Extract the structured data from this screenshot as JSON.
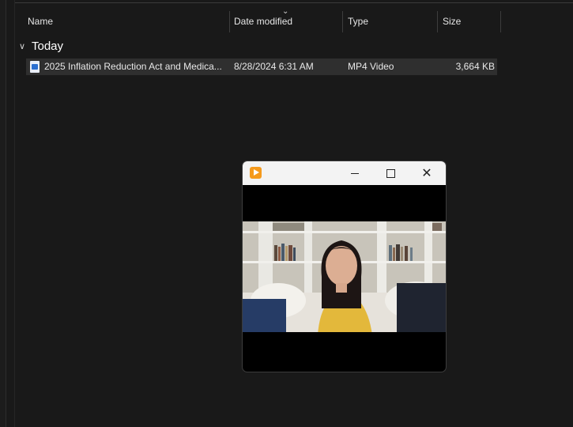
{
  "columns": {
    "name": "Name",
    "date_modified": "Date modified",
    "type": "Type",
    "size": "Size"
  },
  "group": {
    "label": "Today"
  },
  "files": [
    {
      "name": "2025 Inflation Reduction Act and Medica...",
      "date_modified": "8/28/2024 6:31 AM",
      "type": "MP4 Video",
      "size": "3,664 KB",
      "icon": "video-file-icon"
    }
  ],
  "player": {
    "app_icon": "media-player-icon",
    "controls": [
      "minimize-icon",
      "maximize-icon",
      "close-icon"
    ],
    "close_glyph": "✕"
  }
}
